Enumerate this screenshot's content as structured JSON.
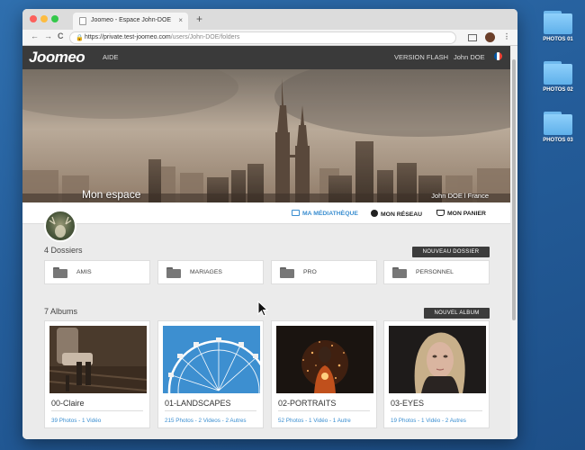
{
  "desktop": {
    "icons": [
      {
        "label": "PHOTOS 01"
      },
      {
        "label": "PHOTOS 02"
      },
      {
        "label": "PHOTOS 03"
      }
    ]
  },
  "browser": {
    "tab_title": "Joomeo - Espace John-DOE",
    "tab_close": "×",
    "new_tab": "+",
    "url_host": "https://private.test-joomeo.com",
    "url_path": "/users/John-DOE/folders",
    "nav": {
      "back": "←",
      "forward": "→",
      "reload": "C"
    },
    "menu": "⋮"
  },
  "site": {
    "logo": "Joomeo",
    "help": "AIDE",
    "flash": "VERSION FLASH",
    "user": "John DOE",
    "flag_colors": [
      "#0055a4",
      "#ffffff",
      "#ef4135"
    ]
  },
  "hero": {
    "caption": "Mon espace",
    "user_location": "John DOE l France"
  },
  "subnav": {
    "media": "MA MÉDIATHÈQUE",
    "network": "MON RÉSEAU",
    "cart": "MON PANIER",
    "accent": "#3a8ed0"
  },
  "folders": {
    "title": "4 Dossiers",
    "new_button": "NOUVEAU DOSSIER",
    "items": [
      {
        "label": "AMIS"
      },
      {
        "label": "MARIAGES"
      },
      {
        "label": "PRO"
      },
      {
        "label": "PERSONNEL"
      }
    ]
  },
  "albums": {
    "title": "7 Albums",
    "new_button": "NOUVEL ALBUM",
    "items": [
      {
        "title": "00-Claire",
        "meta": "39 Photos - 1 Vidéo"
      },
      {
        "title": "01-LANDSCAPES",
        "meta": "215 Photos - 2 Videos - 2 Autres"
      },
      {
        "title": "02-PORTRAITS",
        "meta": "52 Photos - 1 Vidéo - 1 Autre"
      },
      {
        "title": "03-EYES",
        "meta": "19 Photos - 1 Vidéo - 2 Autres"
      }
    ]
  }
}
